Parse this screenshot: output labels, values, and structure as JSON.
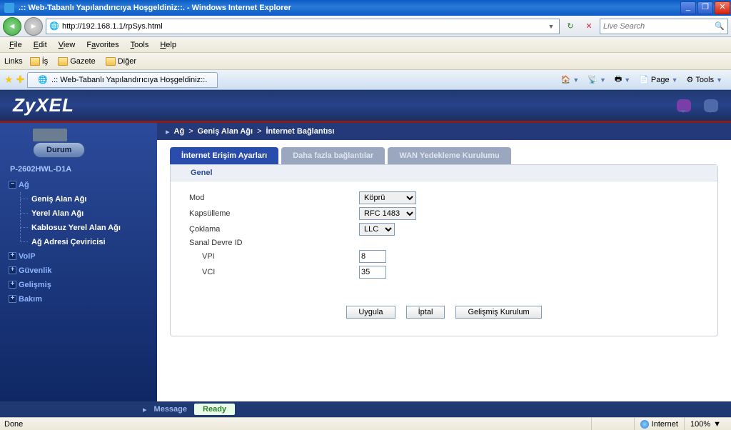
{
  "window": {
    "title": ".:: Web-Tabanlı Yapılandırıcıya Hoşgeldiniz::. - Windows Internet Explorer",
    "url": "http://192.168.1.1/rpSys.html",
    "search_placeholder": "Live Search",
    "tab_title": ".:: Web-Tabanlı Yapılandırıcıya Hoşgeldiniz::.",
    "status_done": "Done",
    "zone": "Internet",
    "zoom": "100%"
  },
  "menus": {
    "file": "File",
    "edit": "Edit",
    "view": "View",
    "favorites": "Favorites",
    "tools": "Tools",
    "help": "Help",
    "links_label": "Links",
    "links": [
      "İş",
      "Gazete",
      "Diğer"
    ],
    "cmd_page": "Page",
    "cmd_tools": "Tools"
  },
  "router": {
    "brand": "ZyXEL",
    "breadcrumb": [
      "Ağ",
      "Geniş Alan Ağı",
      "İnternet Bağlantısı"
    ],
    "status_btn": "Durum",
    "device": "P-2602HWL-D1A",
    "nav": {
      "ag": "Ağ",
      "ag_children": [
        "Geniş Alan Ağı",
        "Yerel Alan Ağı",
        "Kablosuz Yerel Alan Ağı",
        "Ağ Adresi Çeviricisi"
      ],
      "voip": "VoIP",
      "guvenlik": "Güvenlik",
      "gelismis": "Gelişmiş",
      "bakim": "Bakım"
    },
    "tabs": [
      "İnternet Erişim Ayarları",
      "Daha fazla bağlantılar",
      "WAN Yedekleme Kurulumu"
    ],
    "section": "Genel",
    "form": {
      "mod_label": "Mod",
      "mod_value": "Köprü",
      "kapsulleme_label": "Kapsülleme",
      "kapsulleme_value": "RFC 1483",
      "coklama_label": "Çoklama",
      "coklama_value": "LLC",
      "sanal_label": "Sanal Devre ID",
      "vpi_label": "VPI",
      "vpi_value": "8",
      "vci_label": "VCI",
      "vci_value": "35"
    },
    "buttons": {
      "uygula": "Uygula",
      "iptal": "İptal",
      "gelismis": "Gelişmiş Kurulum"
    },
    "message_label": "Message",
    "message_value": "Ready"
  }
}
